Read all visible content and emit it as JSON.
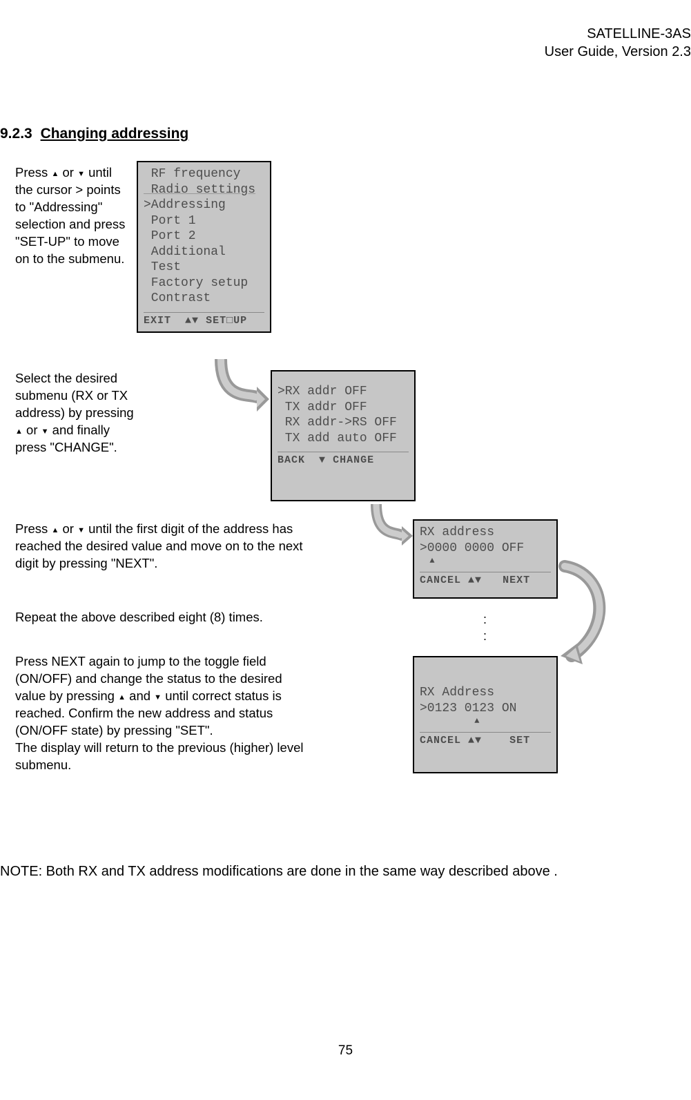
{
  "header": {
    "product": "SATELLINE-3AS",
    "guide": "User Guide, Version 2.3"
  },
  "section": {
    "number": "9.2.3",
    "title": "Changing addressing"
  },
  "para1_a": "Press ",
  "para1_b": " or ",
  "para1_c": " until the cursor > points to \"Addressing\" selection and press \"SET-UP\" to move on to the submenu.",
  "para2_a": "Select the desired submenu (RX or TX address) by pressing ",
  "para2_b": " or ",
  "para2_c": " and finally press \"CHANGE\".",
  "para3_a": "Press ",
  "para3_b": " or ",
  "para3_c": " until the first digit of the address has reached the desired value and move on to the next digit by pressing \"NEXT\".",
  "para4": "Repeat the above described eight (8) times.",
  "para5_a": "Press NEXT again to jump to the toggle field (ON/OFF) and change the status to the desired value by pressing ",
  "para5_b": " and ",
  "para5_c": " until correct status is reached. Confirm the new address and status (ON/OFF state) by pressing \"SET\".",
  "para5_d": "The display will return to the previous (higher) level submenu.",
  "lcd1": {
    "l0": " RF frequency",
    "l1": " Radio settings",
    "l2": ">Addressing",
    "l3": " Port 1",
    "l4": " Port 2",
    "l5": " Additional",
    "l6": " Test",
    "l7": " Factory setup",
    "l8": " Contrast",
    "foot_left": "EXIT",
    "foot_mid": "▲▼",
    "foot_right": "SET□UP"
  },
  "lcd2": {
    "l0": ">RX addr OFF",
    "l1": " TX addr OFF",
    "l2": " RX addr->RS OFF",
    "l3": " TX add auto OFF",
    "foot_left": "BACK",
    "foot_mid": "▼",
    "foot_right": "CHANGE"
  },
  "lcd3": {
    "l0": "RX address",
    "l1": ">0000 0000 OFF",
    "indicator": "  ▲",
    "foot_left": "CANCEL",
    "foot_mid": "▲▼",
    "foot_right": "NEXT"
  },
  "dots": ":\n:",
  "lcd4": {
    "l0": "RX Address",
    "l1": ">0123 0123 ON",
    "indicator": "           ▲",
    "foot_left": "CANCEL",
    "foot_mid": "▲▼",
    "foot_right": "SET"
  },
  "note": {
    "label": "NOTE",
    "text": ": Both RX and TX address modifications are done in the same way described above ."
  },
  "page_number": "75"
}
